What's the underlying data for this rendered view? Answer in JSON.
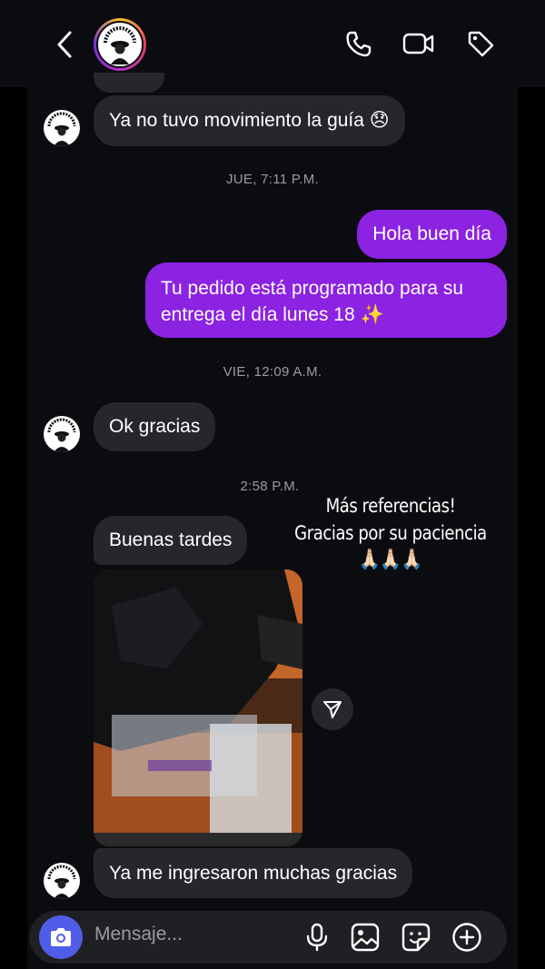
{
  "header": {
    "contact_name_on_logo": "SHELBY CAPS",
    "icons": [
      "back-chevron-icon",
      "phone-icon",
      "video-camera-icon",
      "tag-icon"
    ]
  },
  "messages": [
    {
      "type": "in",
      "text": "Ya no tuvo movimiento la guía 😞"
    },
    {
      "type": "timestamp",
      "text": "JUE, 7:11 P.M."
    },
    {
      "type": "out",
      "text": "Hola buen día"
    },
    {
      "type": "out",
      "line1": "Tu pedido está programado para su",
      "line2": "entrega el día lunes 18 ✨"
    },
    {
      "type": "timestamp",
      "text": "VIE, 12:09 A.M."
    },
    {
      "type": "in",
      "text": "Ok gracias"
    },
    {
      "type": "timestamp",
      "text": "2:58 P.M."
    },
    {
      "type": "in",
      "text": "Buenas tardes"
    },
    {
      "type": "in",
      "text": "Ya me ingresaron muchas gracias"
    }
  ],
  "overlay": {
    "line1": "Más referencias!",
    "line2": "Gracias por su paciencia",
    "emoji": "🙏🏻🙏🏻🙏🏻"
  },
  "composer": {
    "placeholder": "Mensaje...",
    "icons": [
      "camera-icon",
      "microphone-icon",
      "image-icon",
      "sticker-icon",
      "plus-icon"
    ]
  },
  "colors": {
    "background": "#0b0c10",
    "incoming_bubble": "#26272c",
    "outgoing_bubble": "#8c22e2",
    "camera_button": "#4f5de8",
    "timestamp": "#9a9ca3"
  }
}
